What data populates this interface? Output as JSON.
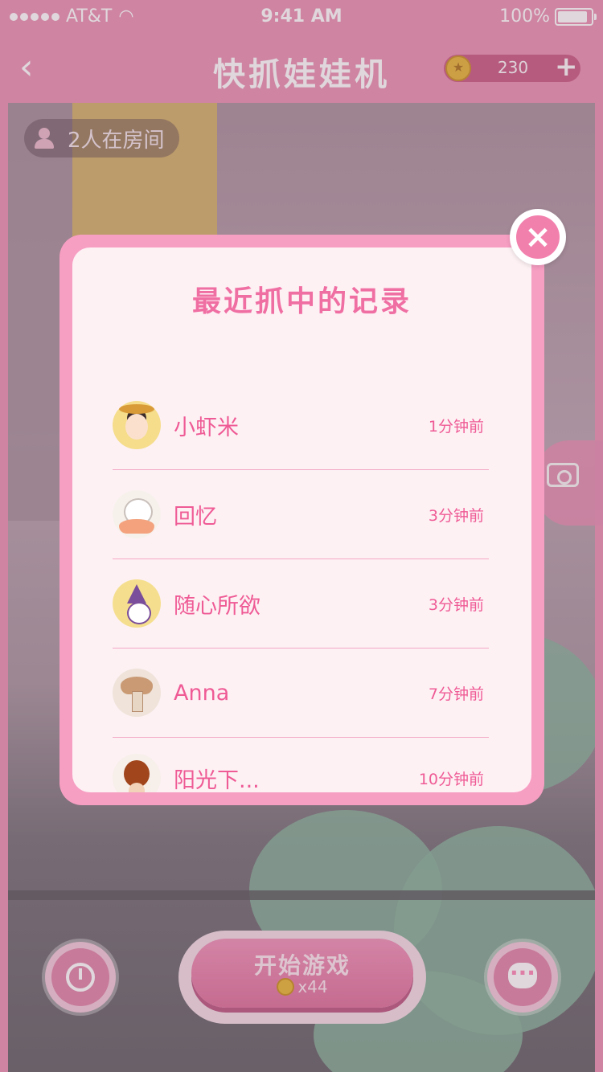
{
  "status_bar": {
    "carrier": "AT&T",
    "time": "9:41 AM",
    "battery": "100%",
    "battery_level": 1.0
  },
  "header": {
    "title": "快抓娃娃机",
    "coin_balance": "230"
  },
  "room": {
    "count_text": "2人在房间"
  },
  "modal": {
    "title": "最近抓中的记录",
    "records": [
      {
        "name": "小虾米",
        "time": "1分钟前"
      },
      {
        "name": "回忆",
        "time": "3分钟前"
      },
      {
        "name": "随心所欲",
        "time": "3分钟前"
      },
      {
        "name": "Anna",
        "time": "7分钟前"
      },
      {
        "name": "阳光下...",
        "time": "10分钟前"
      }
    ]
  },
  "start": {
    "label": "开始游戏",
    "cost": "x44"
  },
  "icons": [
    "back-arrow-icon",
    "coin-icon",
    "plus-icon",
    "user-icon",
    "camera-switch-icon",
    "close-icon",
    "history-clock-icon",
    "chat-icon"
  ],
  "colors": {
    "accent": "#f06fa3",
    "modal_border": "#f79ec3",
    "sheet": "#fdf1f4"
  }
}
